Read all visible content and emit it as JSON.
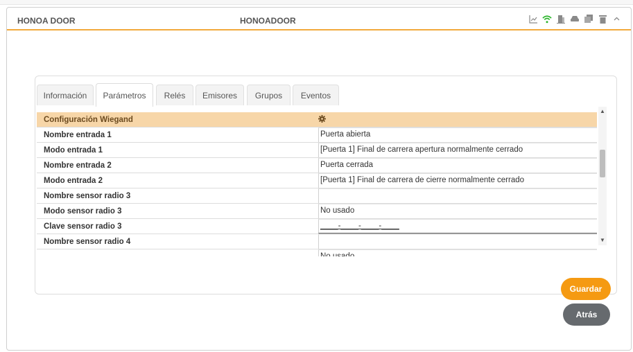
{
  "header": {
    "brand": "HONOA DOOR",
    "title": "HONOADOOR",
    "icons": [
      "chart-icon",
      "wifi-icon",
      "door-icon",
      "car-icon",
      "copy-icon",
      "trash-icon",
      "chevron-up-icon"
    ],
    "accent_color": "#f2a93b"
  },
  "tabs": [
    {
      "label": "Información"
    },
    {
      "label": "Parámetros",
      "active": true
    },
    {
      "label": "Relés"
    },
    {
      "label": "Emisores"
    },
    {
      "label": "Grupos"
    },
    {
      "label": "Eventos"
    }
  ],
  "table": {
    "section_title": "Configuración Wiegand",
    "rows": [
      {
        "label": "Nombre entrada 1",
        "value": "Puerta abierta"
      },
      {
        "label": "Modo entrada 1",
        "value": "[Puerta 1] Final de carrera apertura normalmente cerrado"
      },
      {
        "label": "Nombre entrada 2",
        "value": "Puerta cerrada"
      },
      {
        "label": "Modo entrada 2",
        "value": "[Puerta 1] Final de carrera de cierre normalmente cerrado"
      },
      {
        "label": "Nombre sensor radio 3",
        "value": ""
      },
      {
        "label": "Modo sensor radio 3",
        "value": "No usado"
      },
      {
        "label": "Clave sensor radio 3",
        "value": "____-____-____-____"
      },
      {
        "label": "Nombre sensor radio 4",
        "value": ""
      },
      {
        "label": "",
        "value": "No usado"
      }
    ]
  },
  "buttons": {
    "save": "Guardar",
    "back": "Atrás"
  }
}
